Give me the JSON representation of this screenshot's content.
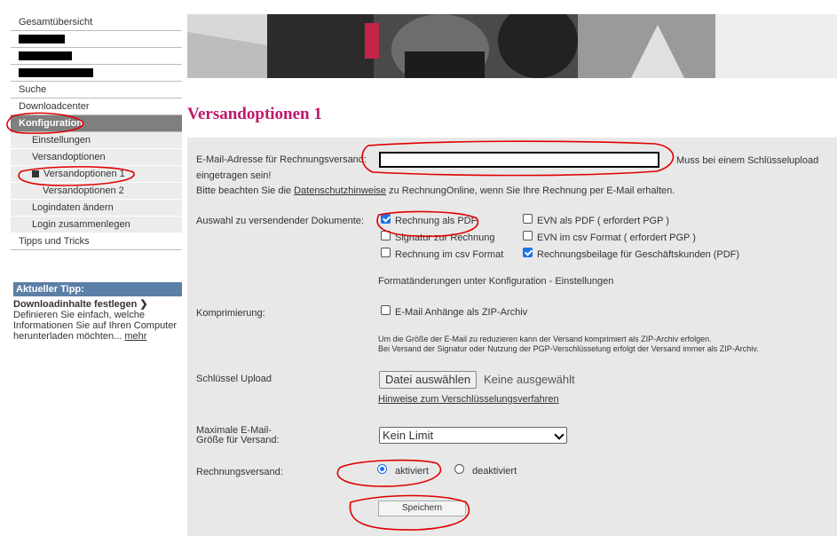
{
  "sidebar": {
    "items": [
      {
        "label": "Gesamtübersicht"
      },
      {
        "label": ""
      },
      {
        "label": ""
      },
      {
        "label": ""
      },
      {
        "label": "Suche"
      },
      {
        "label": "Downloadcenter"
      },
      {
        "label": "Konfiguration"
      },
      {
        "label": "Einstellungen"
      },
      {
        "label": "Versandoptionen"
      },
      {
        "label": "Versandoptionen 1"
      },
      {
        "label": "Versandoptionen 2"
      },
      {
        "label": "Logindaten ändern"
      },
      {
        "label": "Login zusammenlegen"
      },
      {
        "label": "Tipps und Tricks"
      }
    ]
  },
  "tip": {
    "header": "Aktueller Tipp:",
    "title": "Downloadinhalte festlegen",
    "body": "Definieren Sie einfach, welche Informationen Sie auf Ihren Computer herunterladen möchten...",
    "more": "mehr"
  },
  "page": {
    "title": "Versandoptionen 1"
  },
  "form": {
    "email_label": "E-Mail-Adresse für Rechnungsversand:",
    "email_value": "",
    "email_note_1": "Muss bei einem Schlüsselupload",
    "email_note_2": "eingetragen sein!",
    "privacy_pre": "Bitte beachten Sie die ",
    "privacy_link": "Datenschutzhinweise",
    "privacy_post": " zu RechnungOnline, wenn Sie Ihre Rechnung per E-Mail erhalten.",
    "docs_label": "Auswahl zu versendender Dokumente:",
    "docs": [
      {
        "label": "Rechnung als PDF",
        "checked": true
      },
      {
        "label": "EVN als PDF ( erfordert PGP )",
        "checked": false
      },
      {
        "label": "Signatur zur Rechnung",
        "checked": false
      },
      {
        "label": "EVN im csv Format ( erfordert PGP )",
        "checked": false
      },
      {
        "label": "Rechnung im csv Format",
        "checked": false
      },
      {
        "label": "Rechnungsbeilage für Geschäftskunden (PDF)",
        "checked": true
      }
    ],
    "format_note": "Formatänderungen unter Konfiguration - Einstellungen",
    "compress_label": "Komprimierung:",
    "compress_option": "E-Mail Anhänge als ZIP-Archiv",
    "compress_checked": false,
    "compress_note_1": "Um die Größe der E-Mail zu reduzieren kann der Versand komprimiert als ZIP-Archiv erfolgen.",
    "compress_note_2": "Bei Versand der Signatur oder Nutzung der PGP-Verschlüsselung erfolgt der Versand immer als ZIP-Archiv.",
    "key_label": "Schlüssel Upload",
    "file_button": "Datei auswählen",
    "file_status": "Keine ausgewählt",
    "key_link": "Hinweise zum Verschlüsselungsverfahren",
    "size_label_1": "Maximale E-Mail-",
    "size_label_2": "Größe für Versand:",
    "size_value": "Kein Limit",
    "dispatch_label": "Rechnungsversand:",
    "dispatch_on": "aktiviert",
    "dispatch_off": "deaktiviert",
    "dispatch_selected": "aktiviert",
    "save_button": "Speichern"
  },
  "colors": {
    "title": "#c0176c",
    "active_nav": "#7f7f7f",
    "tip_header": "#5b7fa6",
    "panel": "#e8e8e8",
    "checkbox_accent": "#1a73e8",
    "annotation": "#e00000"
  }
}
